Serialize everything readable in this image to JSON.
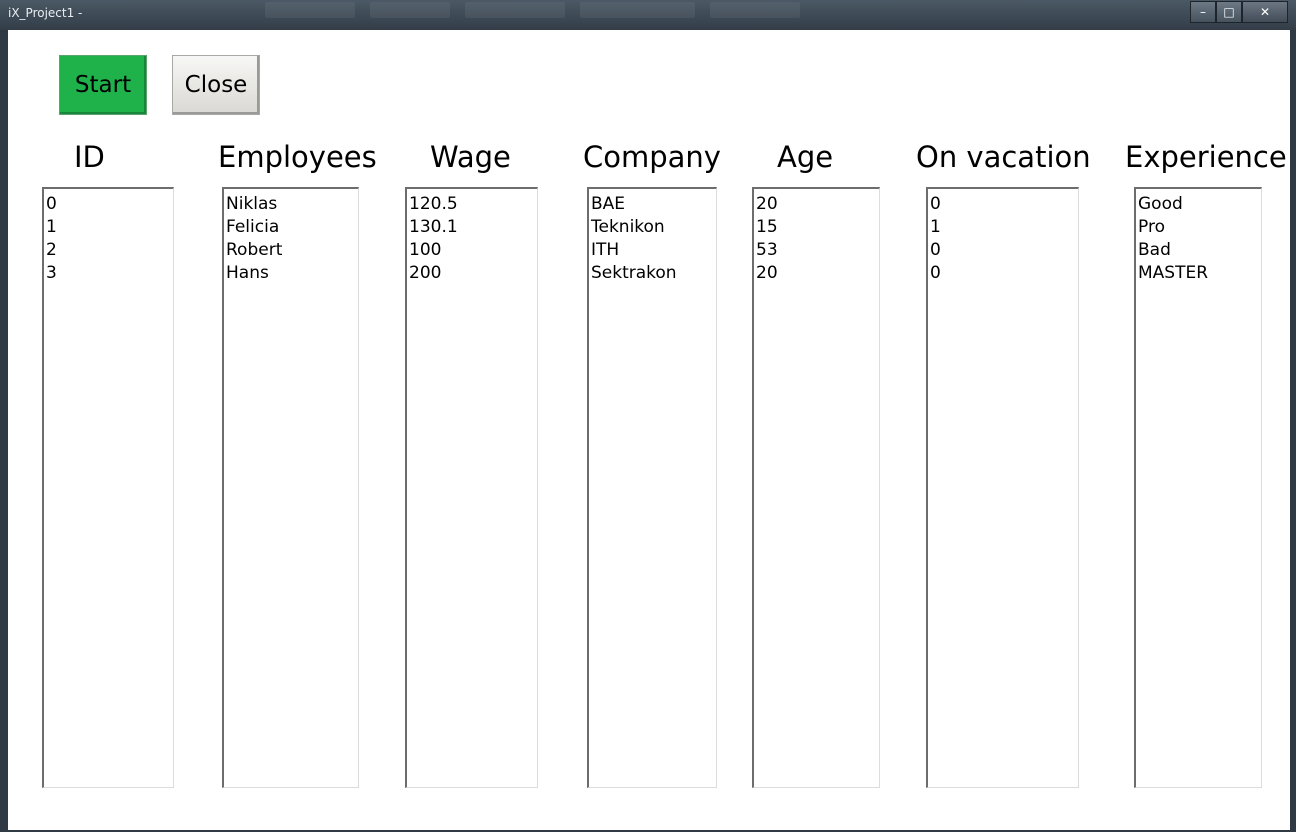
{
  "window": {
    "title": "iX_Project1 -"
  },
  "buttons": {
    "start": "Start",
    "close": "Close"
  },
  "colors": {
    "start_button": "#1fb14a"
  },
  "columns": [
    {
      "header": "ID",
      "items": [
        "0",
        "1",
        "2",
        "3"
      ]
    },
    {
      "header": "Employees",
      "items": [
        "Niklas",
        "Felicia",
        "Robert",
        "Hans"
      ]
    },
    {
      "header": "Wage",
      "items": [
        "120.5",
        "130.1",
        "100",
        "200"
      ]
    },
    {
      "header": "Company",
      "items": [
        "BAE",
        "Teknikon",
        "ITH",
        "Sektrakon"
      ]
    },
    {
      "header": "Age",
      "items": [
        "20",
        "15",
        "53",
        "20"
      ]
    },
    {
      "header": "On vacation",
      "items": [
        "0",
        "1",
        "0",
        "0"
      ]
    },
    {
      "header": "Experience",
      "items": [
        "Good",
        "Pro",
        "Bad",
        "MASTER"
      ]
    }
  ]
}
